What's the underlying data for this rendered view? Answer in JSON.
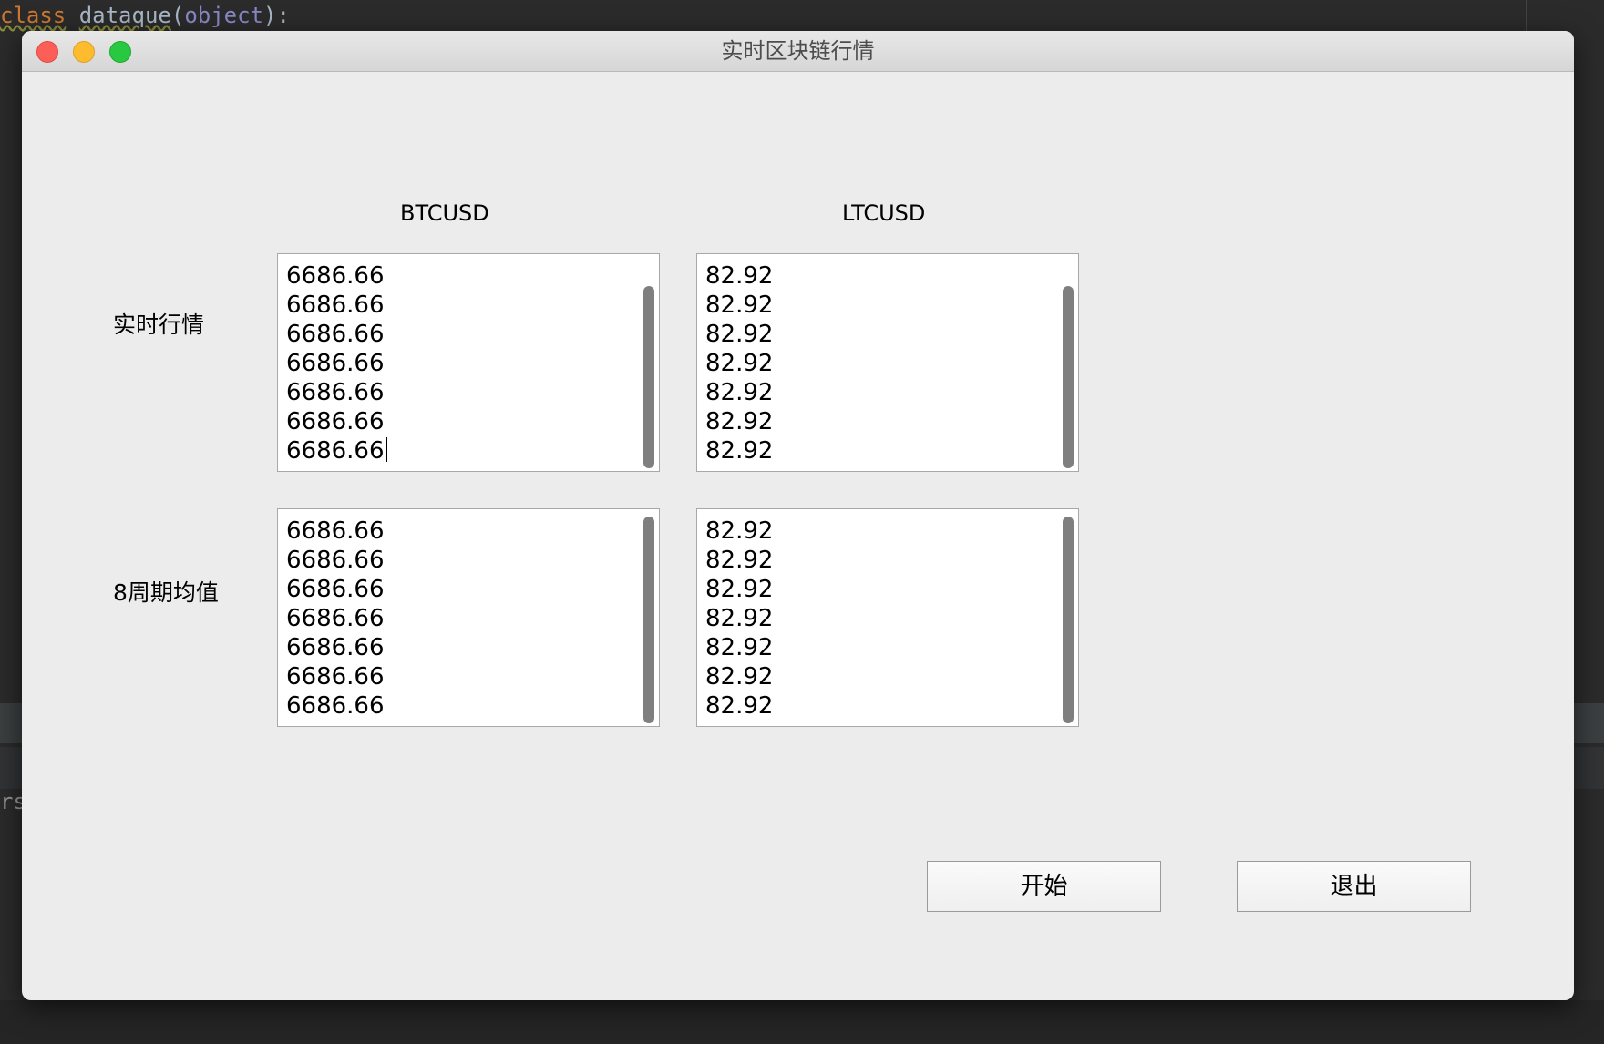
{
  "ide": {
    "code_kw": "class",
    "code_fn": "dataque",
    "code_open": "(",
    "code_obj": "object",
    "code_close": "):",
    "path_fragment": "rs/"
  },
  "window": {
    "title": "实时区块链行情",
    "controls": [
      "close",
      "minimize",
      "zoom"
    ]
  },
  "columns": {
    "btc": "BTCUSD",
    "ltc": "LTCUSD"
  },
  "rows": {
    "realtime": "实时行情",
    "ma8": "8周期均值"
  },
  "lists": {
    "btc_realtime": [
      "6686.66",
      "6686.66",
      "6686.66",
      "6686.66",
      "6686.66",
      "6686.66",
      "6686.66"
    ],
    "ltc_realtime": [
      "82.92",
      "82.92",
      "82.92",
      "82.92",
      "82.92",
      "82.92",
      "82.92"
    ],
    "btc_ma8": [
      "6686.66",
      "6686.66",
      "6686.66",
      "6686.66",
      "6686.66",
      "6686.66",
      "6686.66"
    ],
    "ltc_ma8": [
      "82.92",
      "82.92",
      "82.92",
      "82.92",
      "82.92",
      "82.92",
      "82.92"
    ]
  },
  "buttons": {
    "start": "开始",
    "quit": "退出"
  }
}
